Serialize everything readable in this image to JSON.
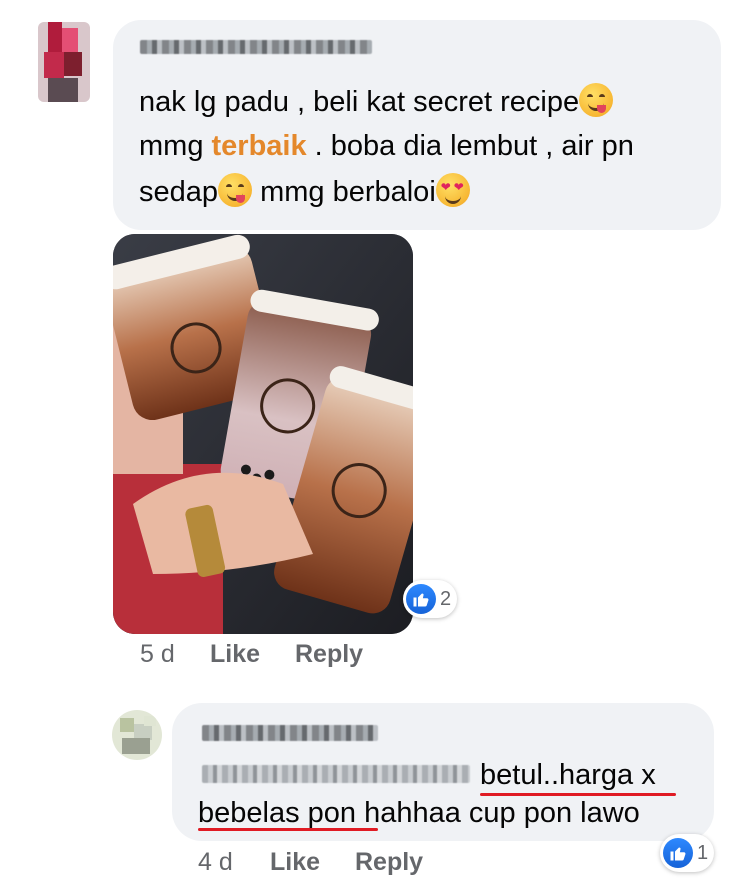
{
  "comment1": {
    "lines": [
      [
        "nak lg padu , beli kat secret recipe"
      ],
      [
        "mmg ",
        "terbaik",
        " . boba dia lembut , air pn"
      ],
      [
        "sedap",
        " mmg berbaloi"
      ]
    ],
    "highlight_color": "#e4882b",
    "emojis": [
      "face-savoring-food",
      "face-savoring-food",
      "heart-eyes"
    ],
    "timestamp": "5 d",
    "like_label": "Like",
    "reply_label": "Reply",
    "reaction_count": "2",
    "photo_alt": "Three boba milk tea cups held up inside a car"
  },
  "comment2": {
    "text_before": "betul..harga x",
    "text_line2_underlined": "bebelas pon",
    "text_line2_rest": " hahhaa cup pon lawo",
    "timestamp": "4 d",
    "like_label": "Like",
    "reply_label": "Reply",
    "reaction_count": "1"
  },
  "colors": {
    "bubble": "#f0f2f5",
    "meta_text": "#65676b",
    "like_blue": "#1877f2",
    "underline_red": "#e01b24"
  }
}
